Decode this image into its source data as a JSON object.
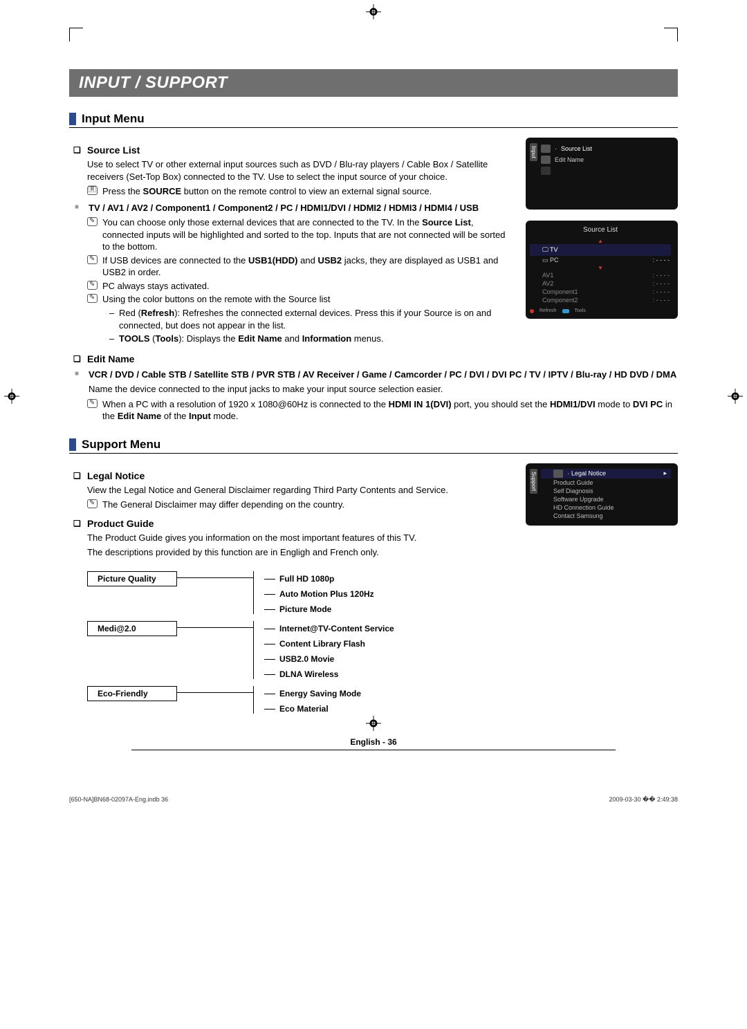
{
  "banner": "INPUT / SUPPORT",
  "sections": {
    "input": "Input Menu",
    "support": "Support Menu"
  },
  "source_list": {
    "heading": "Source List",
    "p1": "Use to select TV or other external input sources such as DVD / Blu-ray players / Cable Box / Satellite receivers (Set-Top Box) connected to the TV. Use to select the input source of your choice.",
    "remote_note_pre": "Press the ",
    "remote_note_bold": "SOURCE",
    "remote_note_post": " button on the remote control to view an external signal source.",
    "inputs": "TV / AV1 / AV2 / Component1 / Component2 / PC / HDMI1/DVI / HDMI2 / HDMI3 / HDMI4 / USB",
    "n1_pre": "You can choose only those external devices that are connected to the TV. In the ",
    "n1_bold": "Source List",
    "n1_post": ", connected inputs will be highlighted and sorted to the top. Inputs that are not connected will be sorted to the bottom.",
    "n2_pre": "If USB devices are connected to the ",
    "n2_b1": "USB1(HDD)",
    "n2_mid": " and ",
    "n2_b2": "USB2",
    "n2_post": " jacks, they are displayed as USB1 and USB2 in order.",
    "n3": "PC always stays activated.",
    "n4": "Using the color buttons on the remote with the Source list",
    "d1_pre": "Red (",
    "d1_b": "Refresh",
    "d1_post": "): Refreshes the connected external devices. Press this if your Source is on and connected, but does not appear in the list.",
    "d2_b1": "TOOLS",
    "d2_paren": " (",
    "d2_b2": "Tools",
    "d2_mid": "): Displays the ",
    "d2_b3": "Edit Name",
    "d2_and": " and ",
    "d2_b4": "Information",
    "d2_end": " menus."
  },
  "edit_name": {
    "heading": "Edit Name",
    "list": "VCR / DVD / Cable STB / Satellite STB / PVR STB / AV Receiver / Game / Camcorder / PC / DVI / DVI PC / TV / IPTV / Blu-ray / HD DVD / DMA",
    "p1": "Name the device connected to the input jacks to make your input source selection easier.",
    "n1_pre": "When a PC with a resolution of 1920 x 1080@60Hz is connected to the ",
    "n1_b1": "HDMI IN 1(DVI)",
    "n1_mid": " port, you should set the ",
    "n1_b2": "HDMI1/DVI",
    "n1_mid2": " mode to ",
    "n1_b3": "DVI PC",
    "n1_mid3": " in the ",
    "n1_b4": "Edit Name",
    "n1_mid4": " of the ",
    "n1_b5": "Input",
    "n1_end": " mode."
  },
  "legal": {
    "heading": "Legal Notice",
    "p1": "View the Legal Notice and General Disclaimer regarding Third Party Contents and Service.",
    "n1": "The General Disclaimer may differ depending on the country."
  },
  "pg": {
    "heading": "Product Guide",
    "p1": "The Product Guide gives you information on the most important features of this TV.",
    "p2": "The descriptions provided by this function are in Engligh and French only."
  },
  "tree": {
    "g1": "Picture Quality",
    "g1_items": [
      "Full HD 1080p",
      "Auto Motion Plus 120Hz",
      "Picture Mode"
    ],
    "g2": "Medi@2.0",
    "g2_items": [
      "Internet@TV-Content Service",
      "Content Library Flash",
      "USB2.0 Movie",
      "DLNA Wireless"
    ],
    "g3": "Eco-Friendly",
    "g3_items": [
      "Energy Saving Mode",
      "Eco Material"
    ]
  },
  "osd1": {
    "side": "Input",
    "r1": "Source List",
    "r2": "Edit Name"
  },
  "osd2": {
    "title": "Source List",
    "tv": "TV",
    "pc": "PC",
    "pcv": ": - - - -",
    "items": [
      "AV1",
      "AV2",
      "Component1",
      "Component2"
    ],
    "vals": ": - - - -",
    "foot1": "Refresh",
    "foot2": "Tools"
  },
  "osd3": {
    "side": "Support",
    "sel": "Legal Notice",
    "items": [
      "Product Guide",
      "Self Diagnosis",
      "Software Upgrade",
      "HD Connection Guide",
      "Contact Samsung"
    ]
  },
  "footer": "English - 36",
  "print": {
    "left": "[650-NA]BN68-02097A-Eng.indb   36",
    "right": "2009-03-30   �� 2:49:38"
  }
}
